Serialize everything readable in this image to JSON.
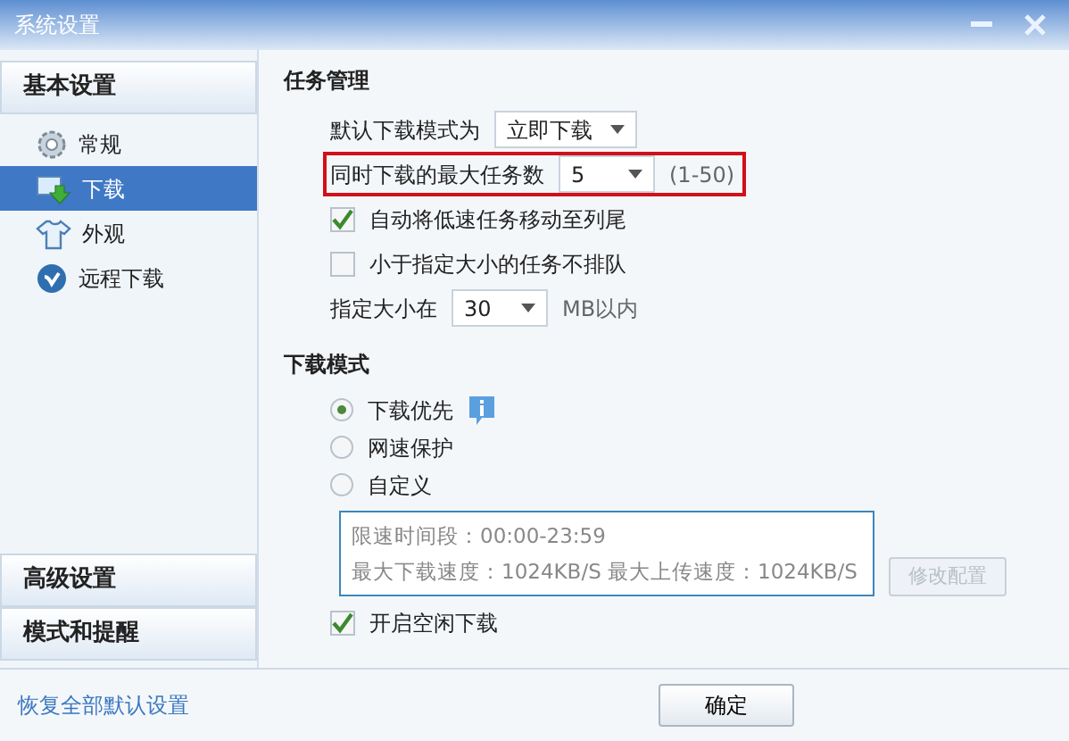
{
  "window": {
    "title": "系统设置"
  },
  "sidebar": {
    "groups": [
      {
        "label": "基本设置",
        "items": [
          {
            "label": "常规",
            "selected": false
          },
          {
            "label": "下载",
            "selected": true
          },
          {
            "label": "外观",
            "selected": false
          },
          {
            "label": "远程下载",
            "selected": false
          }
        ]
      },
      {
        "label": "高级设置"
      },
      {
        "label": "模式和提醒"
      }
    ],
    "restore_link": "恢复全部默认设置"
  },
  "task_section": {
    "title": "任务管理",
    "rows": [
      {
        "kind": "select",
        "label": "默认下载模式为",
        "value": "立即下载",
        "highlighted": false
      },
      {
        "kind": "select",
        "label": "同时下载的最大任务数",
        "value": "5",
        "hint": "(1-50)",
        "highlighted": true
      },
      {
        "kind": "checkbox",
        "label": "自动将低速任务移动至列尾",
        "checked": true
      },
      {
        "kind": "checkbox",
        "label": "小于指定大小的任务不排队",
        "checked": false
      },
      {
        "kind": "select",
        "label": "指定大小在",
        "value": "30",
        "hint": "MB以内",
        "highlighted": false
      }
    ]
  },
  "mode_section": {
    "title": "下载模式",
    "options": [
      {
        "label": "下载优先",
        "selected": true,
        "info": true
      },
      {
        "label": "网速保护",
        "selected": false,
        "info": false
      },
      {
        "label": "自定义",
        "selected": false,
        "info": false
      }
    ],
    "custom_box": {
      "lines": [
        "限速时间段：00:00-23:59",
        "最大下载速度：1024KB/S  最大上传速度：1024KB/S"
      ]
    },
    "edit_button": {
      "label": "修改配置",
      "disabled": true
    },
    "idle_download": {
      "label": "开启空闲下载",
      "checked": true
    }
  },
  "footer": {
    "buttons": [
      "确定"
    ]
  }
}
